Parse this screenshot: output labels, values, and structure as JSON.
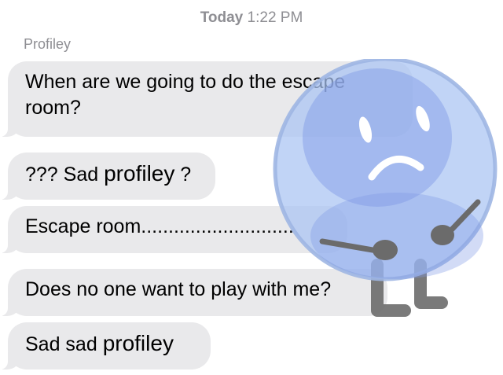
{
  "header": {
    "day": "Today",
    "time": "1:22 PM"
  },
  "thread": {
    "sender": "Profiley",
    "messages": [
      {
        "line1": "When are we going to do the escape",
        "line2": "room?"
      },
      {
        "prefix": "??? Sad ",
        "name": "profiley",
        "suffix": " ?"
      },
      {
        "text": "Escape room............................"
      },
      {
        "text": "Does no one want to play with me?"
      },
      {
        "prefix": "Sad sad ",
        "name": "profiley"
      }
    ]
  },
  "colors": {
    "bubble_received": "#e9e9eb",
    "timestamp_gray": "#8e8e93",
    "character_body": "#a9c4f2",
    "character_limbs": "#6b6b6b"
  },
  "sticker": {
    "icon": "sad-blue-ball-character-icon"
  }
}
